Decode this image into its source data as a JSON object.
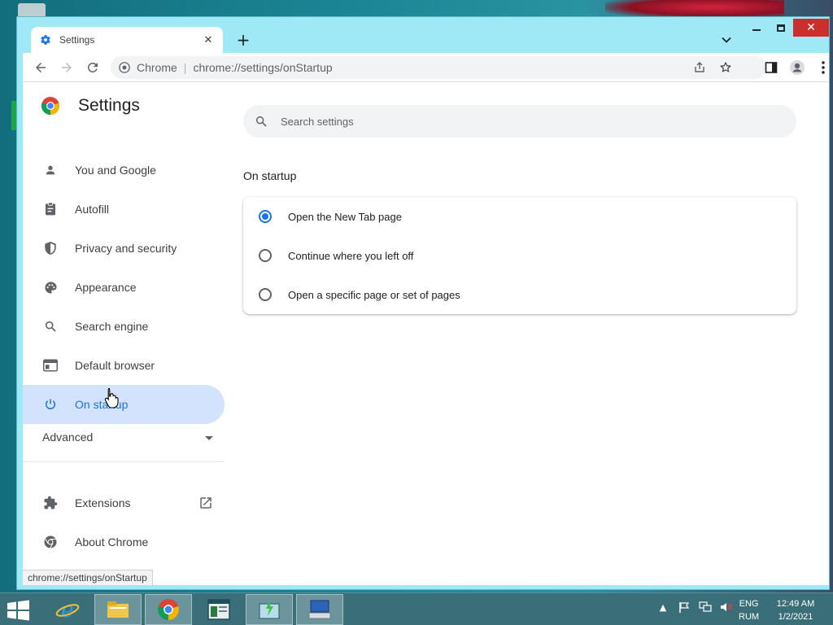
{
  "window": {
    "tab_title": "Settings",
    "close_symbol": "✕"
  },
  "toolbar": {
    "omnibox_site": "Chrome",
    "omnibox_separator": "|",
    "omnibox_url": "chrome://settings/onStartup"
  },
  "sidebar": {
    "title": "Settings",
    "items": [
      {
        "label": "You and Google",
        "icon": "person-icon"
      },
      {
        "label": "Autofill",
        "icon": "clipboard-icon"
      },
      {
        "label": "Privacy and security",
        "icon": "shield-icon"
      },
      {
        "label": "Appearance",
        "icon": "palette-icon"
      },
      {
        "label": "Search engine",
        "icon": "search-icon"
      },
      {
        "label": "Default browser",
        "icon": "browser-window-icon"
      },
      {
        "label": "On startup",
        "icon": "power-icon",
        "active": true
      }
    ],
    "advanced_label": "Advanced",
    "extensions_label": "Extensions",
    "about_label": "About Chrome"
  },
  "main": {
    "search_placeholder": "Search settings",
    "section_title": "On startup",
    "options": [
      {
        "label": "Open the New Tab page",
        "checked": true
      },
      {
        "label": "Continue where you left off",
        "checked": false
      },
      {
        "label": "Open a specific page or set of pages",
        "checked": false
      }
    ]
  },
  "status_bar": {
    "url": "chrome://settings/onStartup"
  },
  "taskbar": {
    "lang_top": "ENG",
    "lang_bottom": "RUM",
    "time": "12:49 AM",
    "date": "1/2/2021"
  },
  "colors": {
    "accent": "#1a73e8",
    "active_nav_bg": "#d3e3fd",
    "close_button": "#c9302c"
  }
}
